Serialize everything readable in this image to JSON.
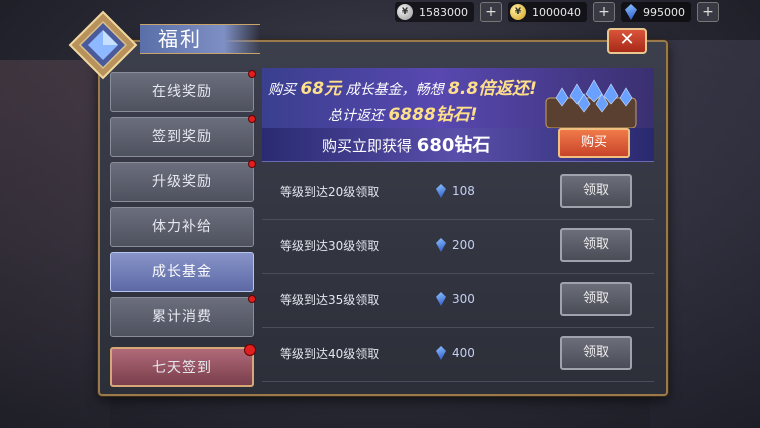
{
  "currencies": [
    {
      "icon": "silver-coin-icon",
      "value": "1583000"
    },
    {
      "icon": "gold-coin-icon",
      "value": "1000040"
    },
    {
      "icon": "diamond-icon",
      "value": "995000"
    }
  ],
  "window": {
    "title": "福利",
    "close_label": "✕"
  },
  "sidebar": {
    "items": [
      {
        "label": "在线奖励",
        "badge": true
      },
      {
        "label": "签到奖励",
        "badge": true
      },
      {
        "label": "升级奖励",
        "badge": true
      },
      {
        "label": "体力补给",
        "badge": false
      },
      {
        "label": "成长基金",
        "badge": false,
        "active": true
      },
      {
        "label": "累计消费",
        "badge": true
      },
      {
        "label": "七天签到",
        "badge": true
      }
    ]
  },
  "banner": {
    "line1_pre": "购买",
    "line1_price": "68元",
    "line1_mid": "成长基金，畅想",
    "line1_rate": "8.8倍返还!",
    "line2_pre": "总计返还",
    "line2_amount": "6888钻石!",
    "buy_pre": "购买立即获得",
    "buy_amount": "680钻石",
    "buy_button": "购买"
  },
  "rewards": [
    {
      "label": "等级到达20级领取",
      "amount": "108",
      "button": "领取"
    },
    {
      "label": "等级到达30级领取",
      "amount": "200",
      "button": "领取"
    },
    {
      "label": "等级到达35级领取",
      "amount": "300",
      "button": "领取"
    },
    {
      "label": "等级到达40级领取",
      "amount": "400",
      "button": "领取"
    }
  ]
}
